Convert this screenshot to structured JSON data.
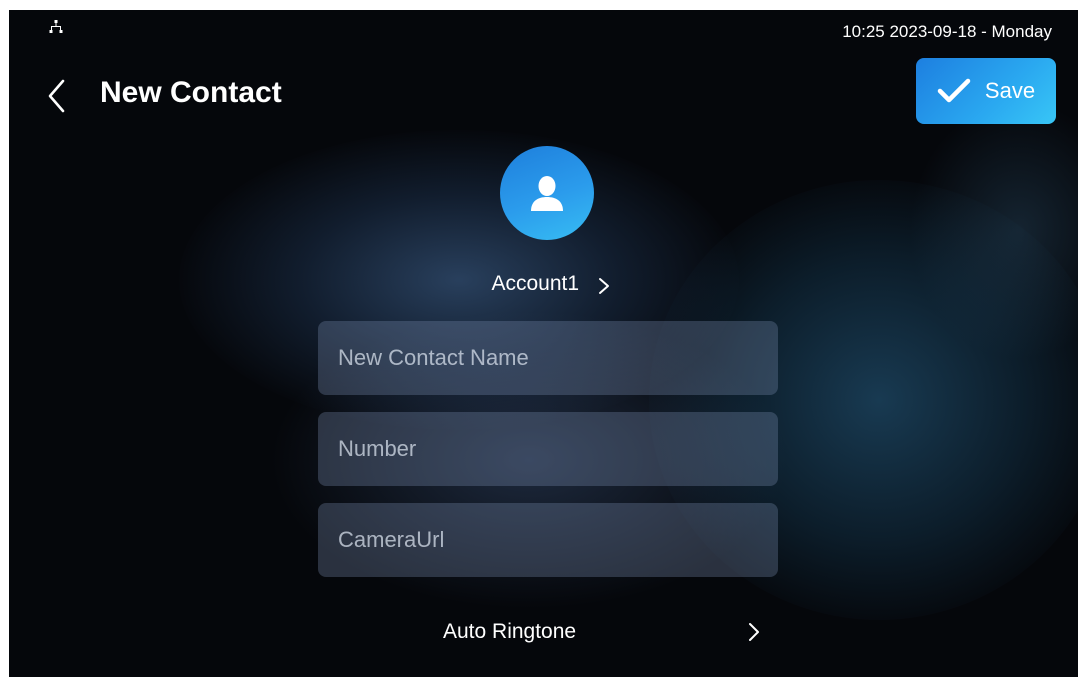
{
  "status_bar": {
    "network_icon": "network-icon",
    "datetime": "10:25  2023-09-18 - Monday"
  },
  "header": {
    "back_icon": "chevron-left-icon",
    "title": "New Contact",
    "save_label": "Save",
    "save_icon": "check-icon"
  },
  "avatar": {
    "icon": "person-icon",
    "color": "#2b9cec"
  },
  "account": {
    "label": "Account1",
    "chevron_icon": "chevron-right-icon"
  },
  "fields": [
    {
      "placeholder": "New Contact Name",
      "value": ""
    },
    {
      "placeholder": "Number",
      "value": ""
    },
    {
      "placeholder": "CameraUrl",
      "value": ""
    }
  ],
  "ringtone": {
    "label": "Auto Ringtone",
    "chevron_icon": "chevron-right-icon"
  },
  "colors": {
    "accent": "#2aa8f0",
    "background": "#05070b"
  }
}
